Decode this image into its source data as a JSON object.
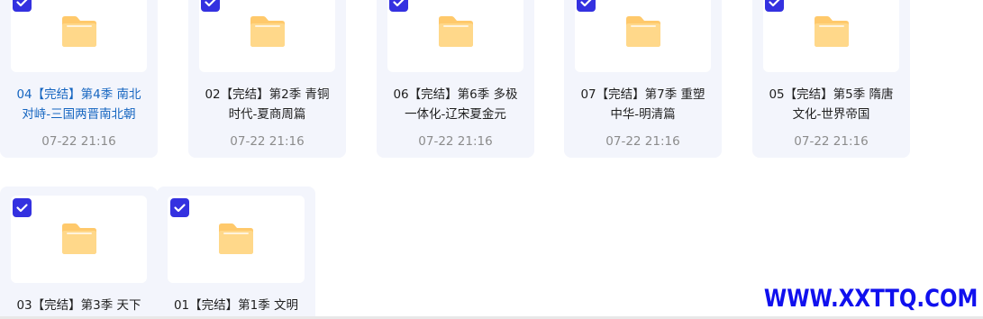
{
  "files": [
    {
      "title_line1": "04【完结】第4季 南北",
      "title_line2": "对峙-三国两晋南北朝",
      "time": "07-22 21:16",
      "highlighted": true,
      "selected": true
    },
    {
      "title_line1": "02【完结】第2季 青铜",
      "title_line2": "时代-夏商周篇",
      "time": "07-22 21:16",
      "highlighted": false,
      "selected": true
    },
    {
      "title_line1": "06【完结】第6季 多极",
      "title_line2": "一体化-辽宋夏金元",
      "time": "07-22 21:16",
      "highlighted": false,
      "selected": true
    },
    {
      "title_line1": "07【完结】第7季 重塑",
      "title_line2": "中华-明清篇",
      "time": "07-22 21:16",
      "highlighted": false,
      "selected": true
    },
    {
      "title_line1": "05【完结】第5季 隋唐",
      "title_line2": "文化-世界帝国",
      "time": "07-22 21:16",
      "highlighted": false,
      "selected": true
    },
    {
      "title_line1": "03【完结】第3季 天下",
      "title_line2": "",
      "time": "",
      "highlighted": false,
      "selected": true
    },
    {
      "title_line1": "01【完结】第1季 文明",
      "title_line2": "",
      "time": "",
      "highlighted": false,
      "selected": true
    }
  ],
  "icons": {
    "folder": "folder-icon",
    "checkbox": "checkbox-checked-icon"
  },
  "colors": {
    "card_bg": "#f3f5fc",
    "accent": "#3431e0",
    "folder": "#ffc96b",
    "title_highlight": "#1565c0",
    "watermark": "#1010ee"
  },
  "watermark": {
    "text": "WWW.XXTTQ.COM"
  }
}
